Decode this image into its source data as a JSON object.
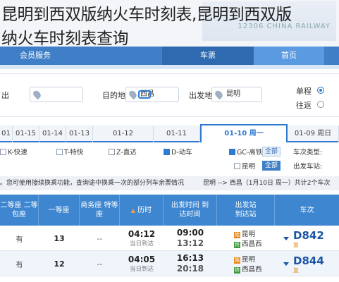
{
  "page_title_line1": "昆明到西双版纳火车时刻表,昆明到西双版",
  "page_title_line2": "纳火车时刻表查询",
  "logo": {
    "text": "12306 CHINA RAILWAY"
  },
  "nav": {
    "items": [
      "会员服务",
      "车票",
      "首页"
    ]
  },
  "search": {
    "from_label": "出发地",
    "from_value": "昆明",
    "to_label": "目的地",
    "to_value": "西昌",
    "left_label": "出",
    "oneway": "单程",
    "roundtrip": "往返"
  },
  "dates": [
    {
      "label": "01"
    },
    {
      "label": "01-15"
    },
    {
      "label": "01-14"
    },
    {
      "label": "01-13"
    },
    {
      "label": "01-12"
    },
    {
      "label": "01-11"
    },
    {
      "label": "01-10 周一"
    },
    {
      "label": "01-09 周日"
    }
  ],
  "filter": {
    "type_label": "车次类型:",
    "all": "全部",
    "types": [
      "GC-高铁/城际",
      "D-动车",
      "Z-直达",
      "T-特快",
      "K-快速"
    ],
    "station_label": "出发车站:",
    "station_all": "全部",
    "station": "昆明"
  },
  "info": {
    "route": "昆明 --> 西昌（1月10日  周一）共计2个车次",
    "note": "您可使用接续换乘功能，查询途中换乘一次的部分列车余票情况。"
  },
  "table": {
    "headers": [
      "车次",
      "出发站 到达站",
      "出发时间 到达时间",
      "历时",
      "商务座 特等座",
      "一等座",
      "二等座 二等包座"
    ],
    "rows": [
      {
        "train": "D842",
        "flag": "复",
        "from": "昆明",
        "to": "西昌西",
        "dep": "09:00",
        "arr": "13:12",
        "dur": "04:12",
        "dur_note": "当日到达",
        "biz": "--",
        "first": "13",
        "second": "有"
      },
      {
        "train": "D844",
        "flag": "复",
        "from": "昆明",
        "to": "西昌西",
        "dep": "16:13",
        "arr": "20:18",
        "dur": "04:05",
        "dur_note": "当日到达",
        "biz": "--",
        "first": "12",
        "second": "有"
      }
    ]
  },
  "colors": {
    "primary": "#3e86d0",
    "nav": "#3e7fc7",
    "start_badge": "#e88a1a",
    "end_badge": "#3f9a3f"
  }
}
